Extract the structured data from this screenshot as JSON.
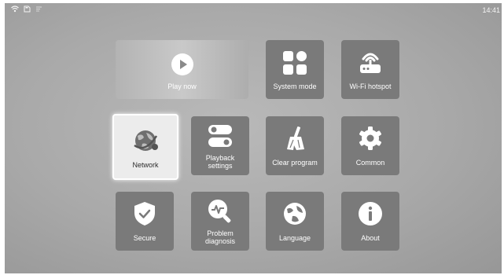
{
  "status_bar": {
    "clock": "14:41",
    "icons": [
      "wifi-icon",
      "sd-card-icon",
      "usb-icon"
    ]
  },
  "menu": {
    "tiles": [
      {
        "label": "Play now",
        "icon": "play-icon"
      },
      {
        "label": "System mode",
        "icon": "grid-icon"
      },
      {
        "label": "Wi-Fi hotspot",
        "icon": "router-icon"
      },
      {
        "label": "Network",
        "icon": "globe-network-icon",
        "selected": true
      },
      {
        "label_line1": "Playback",
        "label_line2": "settings",
        "icon": "toggle-switch-icon"
      },
      {
        "label": "Clear program",
        "icon": "broom-icon"
      },
      {
        "label": "Common",
        "icon": "gear-icon"
      },
      {
        "label": "Secure",
        "icon": "shield-icon"
      },
      {
        "label_line1": "Problem",
        "label_line2": "diagnosis",
        "icon": "magnifier-pulse-icon"
      },
      {
        "label": "Language",
        "icon": "globe-icon"
      },
      {
        "label": "About",
        "icon": "info-icon"
      }
    ]
  },
  "colors": {
    "tile_bg": "#7a7a7a",
    "selected_tile_bg": "#ececec",
    "text": "#ffffff"
  }
}
